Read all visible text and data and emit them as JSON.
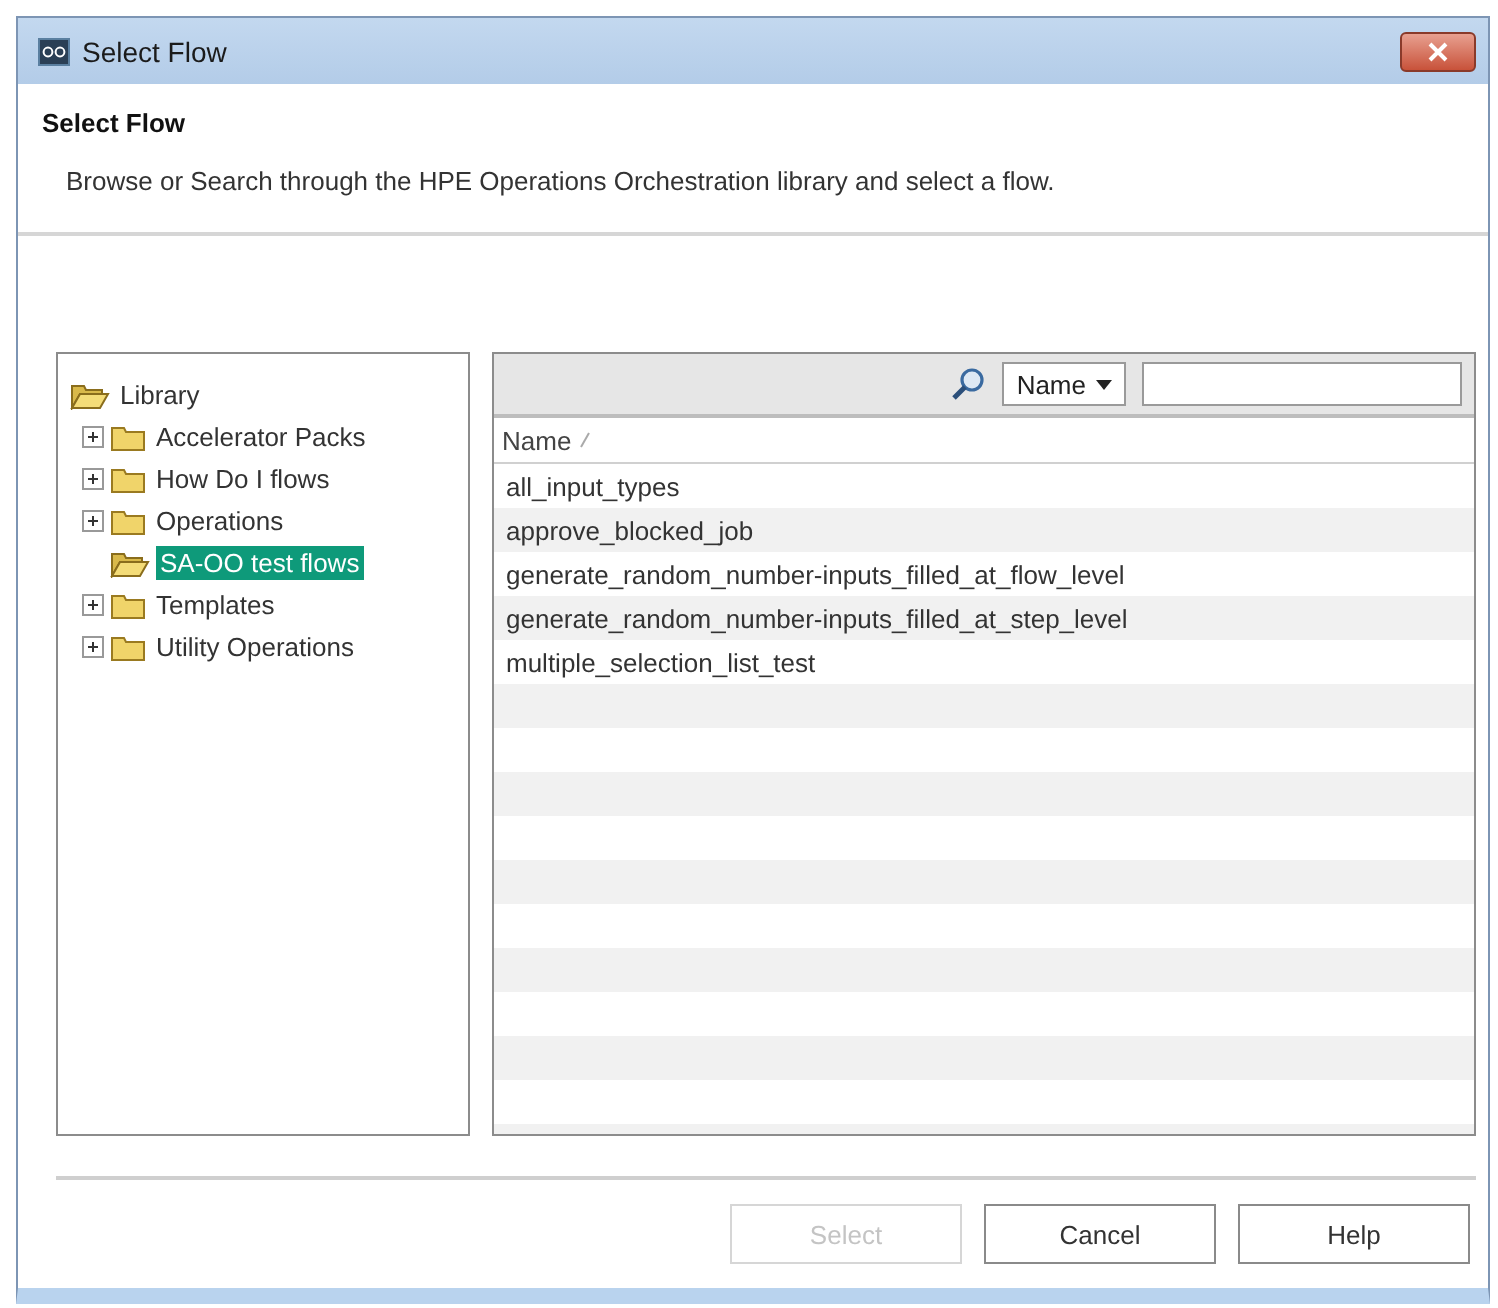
{
  "window": {
    "title": "Select Flow"
  },
  "header": {
    "title": "Select Flow",
    "description": "Browse or Search through the HPE Operations Orchestration library and select a flow."
  },
  "tree": {
    "label": "Library",
    "expanded": true,
    "selected": false,
    "children": [
      {
        "label": "Accelerator Packs",
        "expanded": false,
        "selected": false
      },
      {
        "label": "How Do I flows",
        "expanded": false,
        "selected": false
      },
      {
        "label": "Operations",
        "expanded": false,
        "selected": false
      },
      {
        "label": "SA-OO test flows",
        "expanded": true,
        "selected": true
      },
      {
        "label": "Templates",
        "expanded": false,
        "selected": false
      },
      {
        "label": "Utility Operations",
        "expanded": false,
        "selected": false
      }
    ]
  },
  "search": {
    "field": "Name"
  },
  "table": {
    "columns": [
      "Name"
    ],
    "rows": [
      {
        "name": "all_input_types"
      },
      {
        "name": "approve_blocked_job"
      },
      {
        "name": "generate_random_number-inputs_filled_at_flow_level"
      },
      {
        "name": "generate_random_number-inputs_filled_at_step_level"
      },
      {
        "name": "multiple_selection_list_test"
      }
    ]
  },
  "buttons": [
    {
      "label": "Select",
      "disabled": true
    },
    {
      "label": "Cancel",
      "disabled": false
    },
    {
      "label": "Help",
      "disabled": false
    }
  ]
}
